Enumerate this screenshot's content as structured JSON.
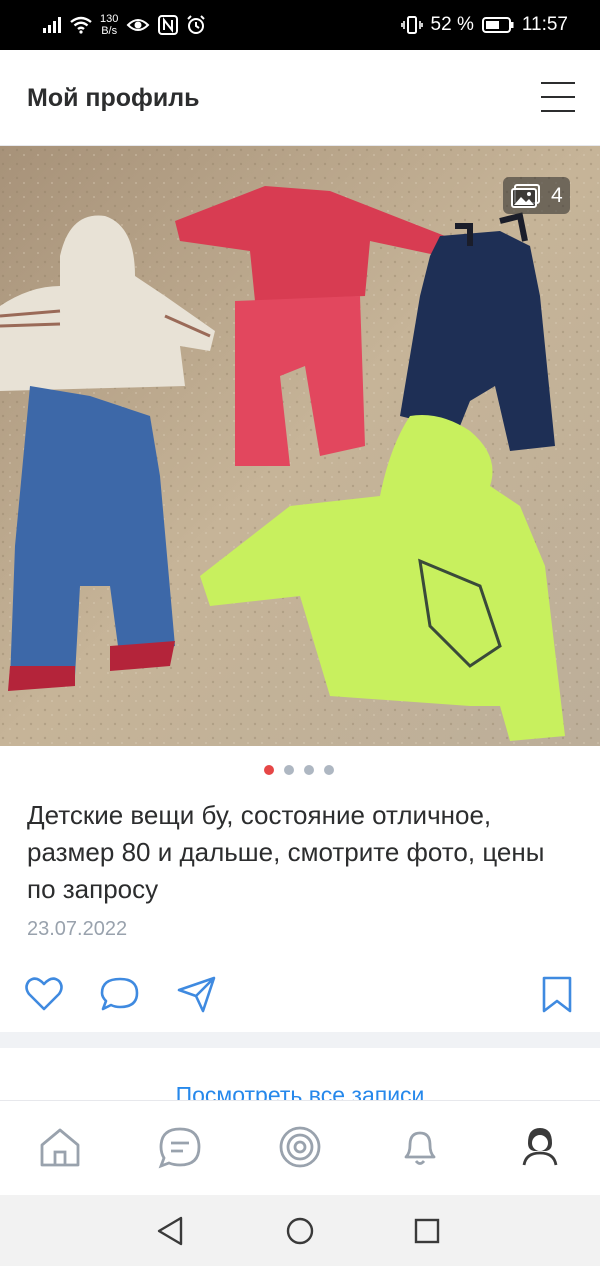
{
  "status_bar": {
    "network_speed_value": "130",
    "network_speed_unit": "B/s",
    "battery_percent": "52 %",
    "time": "11:57"
  },
  "header": {
    "title": "Мой профиль",
    "menu_icon": "hamburger-menu-icon"
  },
  "post": {
    "photo_count": "4",
    "photo_icon": "gallery-icon",
    "carousel_total": 4,
    "carousel_active_index": 0,
    "text": "Детские вещи бу, состояние отличное, размер 80 и дальше, смотрите фото, цены по запросу",
    "date": "23.07.2022"
  },
  "actions": [
    "heart-icon",
    "comment-icon",
    "share-icon",
    "bookmark-icon"
  ],
  "feed": {
    "see_all_label": "Посмотреть все записи"
  },
  "tab_bar": [
    "home-icon",
    "messages-icon",
    "discover-icon",
    "notifications-icon",
    "profile-icon"
  ],
  "system_nav": [
    "back-icon",
    "home-circle-icon",
    "recents-icon"
  ],
  "colors": {
    "accent": "#2688eb",
    "active_dot": "#e64646",
    "text_primary": "#2c2d2e",
    "text_secondary": "#99a2ad",
    "icon": "#3f8ae0"
  }
}
